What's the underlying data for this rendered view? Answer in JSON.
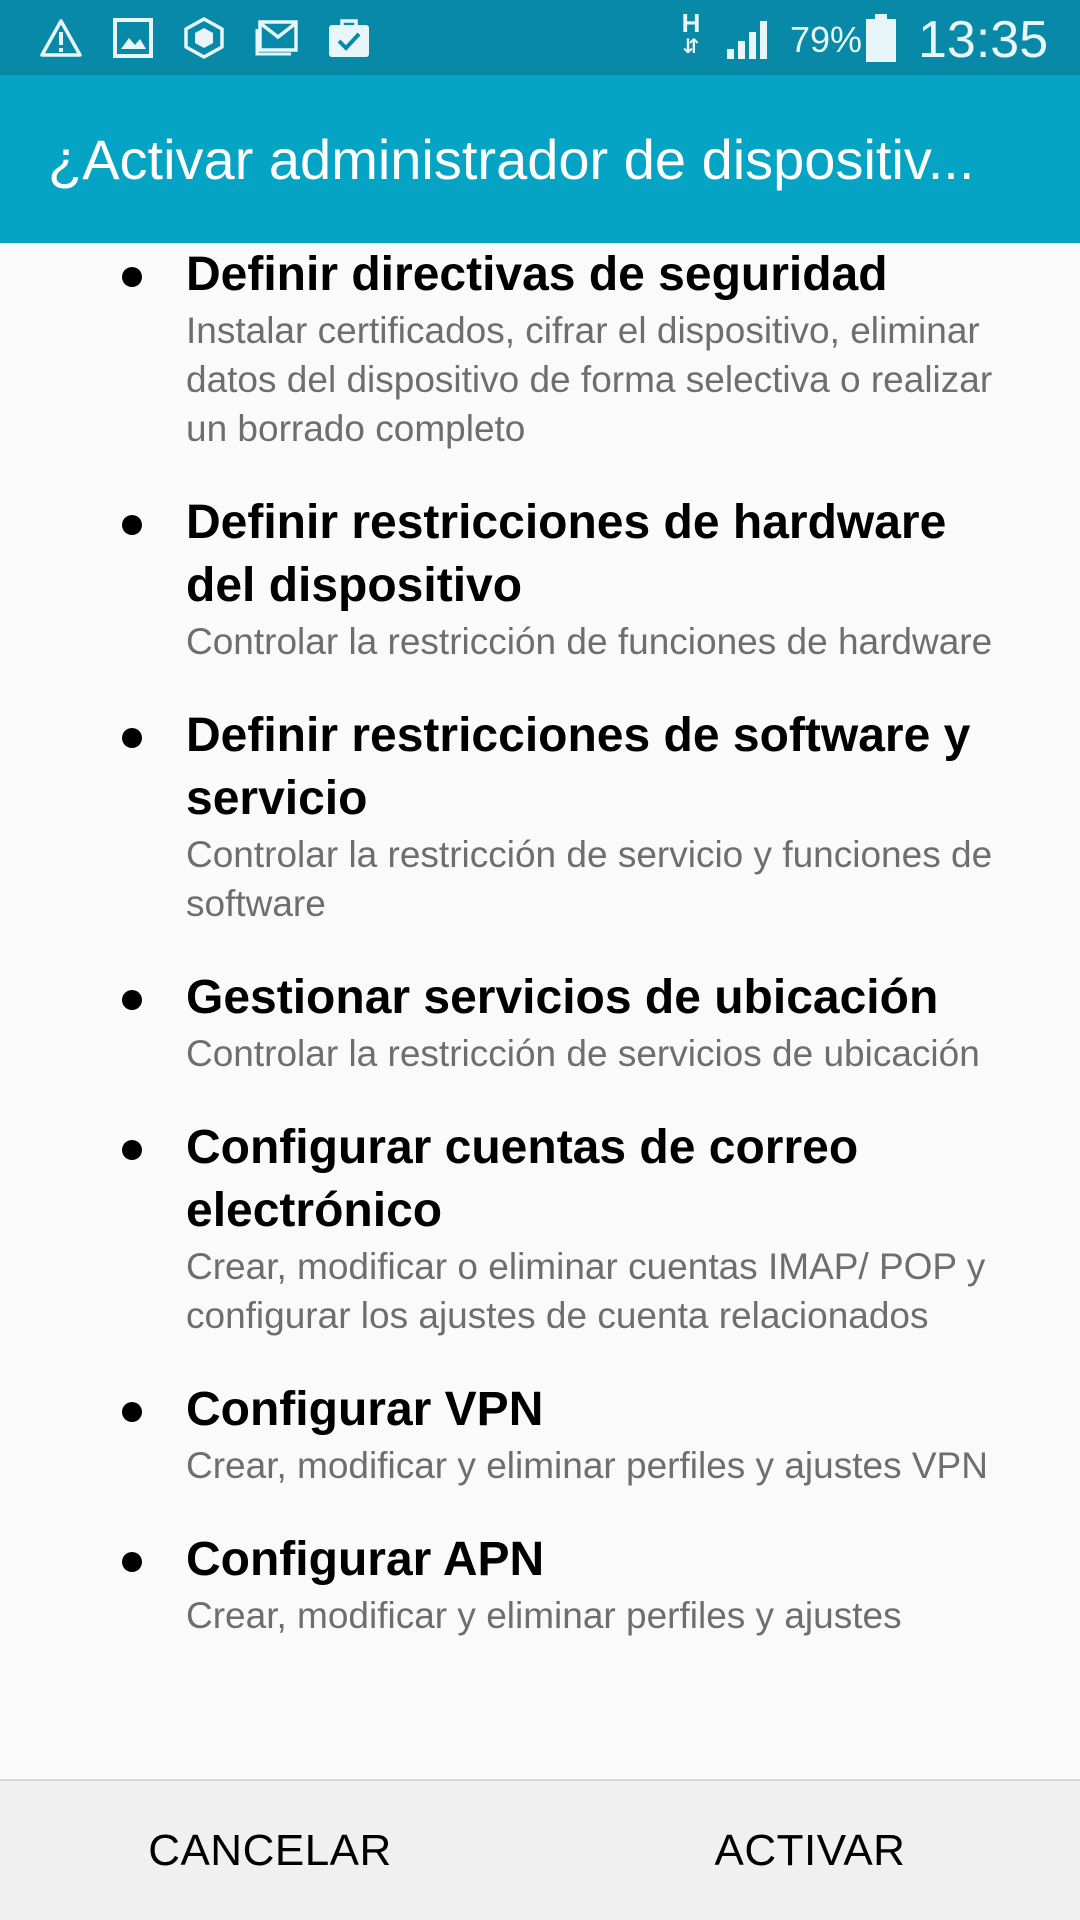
{
  "status_bar": {
    "icons": [
      "warning-icon",
      "gallery-icon",
      "security-cube-icon",
      "email-icon",
      "briefcase-icon",
      "network-type-icon",
      "signal-icon",
      "battery-icon"
    ],
    "network_type": "H",
    "battery_percent": "79%",
    "time": "13:35",
    "background_color": "#0889a8"
  },
  "dialog": {
    "title": "¿Activar administrador de dispositiv...",
    "title_background_color": "#06a4c4"
  },
  "policies": [
    {
      "title": "Definir directivas de seguridad",
      "description": "Instalar certificados, cifrar el dispositivo, eliminar datos del dispositivo de forma selectiva o realizar un borrado completo"
    },
    {
      "title": "Definir restricciones de hardware del dispositivo",
      "description": "Controlar la restricción de funciones de hardware"
    },
    {
      "title": "Definir restricciones de software y servicio",
      "description": "Controlar la restricción de servicio y funciones de software"
    },
    {
      "title": "Gestionar servicios de ubicación",
      "description": "Controlar la restricción de servicios de ubicación"
    },
    {
      "title": "Configurar cuentas de correo electrónico",
      "description": "Crear, modificar o eliminar cuentas IMAP/ POP y configurar los ajustes de cuenta relacionados"
    },
    {
      "title": "Configurar VPN",
      "description": "Crear, modificar y eliminar perfiles y ajustes VPN"
    },
    {
      "title": "Configurar APN",
      "description": "Crear, modificar y eliminar perfiles y ajustes"
    }
  ],
  "buttons": {
    "cancel_label": "CANCELAR",
    "activate_label": "ACTIVAR"
  }
}
